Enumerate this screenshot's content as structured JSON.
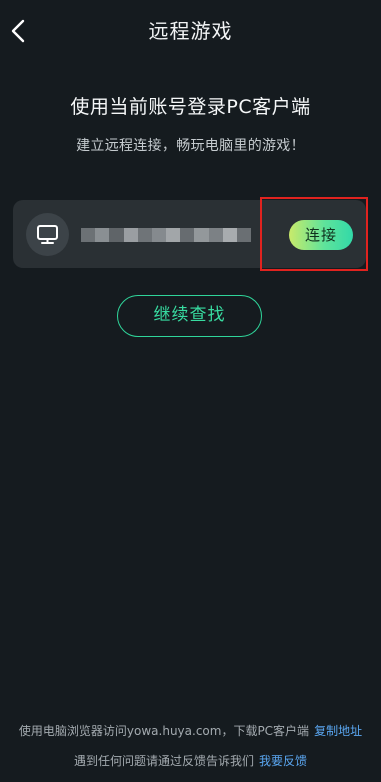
{
  "header": {
    "title": "远程游戏",
    "back_icon": "chevron-left-icon"
  },
  "main": {
    "headline": "使用当前账号登录PC客户端",
    "subline": "建立远程连接，畅玩电脑里的游戏！",
    "device": {
      "icon": "monitor-icon",
      "name_blurred": true,
      "connect_label": "连接"
    },
    "continue_label": "继续查找"
  },
  "footer": {
    "line1_text": "使用电脑浏览器访问yowa.huya.com，下载PC客户端",
    "line1_link": "复制地址",
    "line2_text": "遇到任何问题请通过反馈告诉我们",
    "line2_link": "我要反馈"
  },
  "colors": {
    "background": "#151b1f",
    "card": "#2a3034",
    "accent_green": "#38dba0",
    "link_blue": "#5aa6f0",
    "highlight_red": "#e0231f"
  }
}
